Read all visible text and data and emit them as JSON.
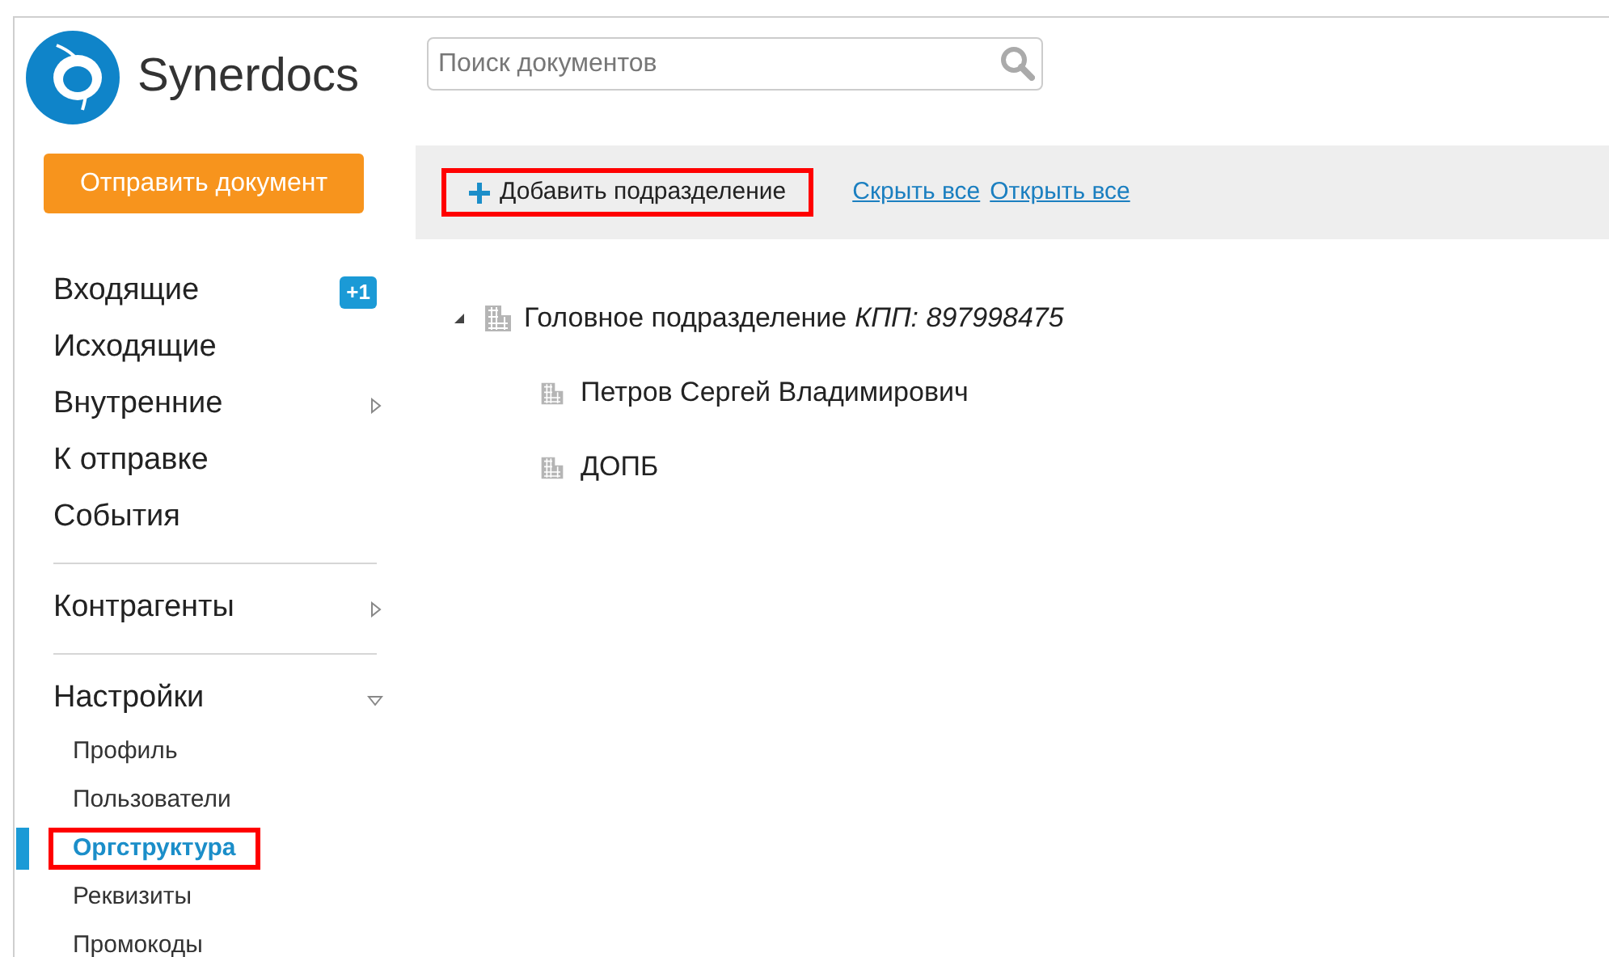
{
  "header": {
    "logo_text": "Synerdocs",
    "search": {
      "placeholder": "Поиск документов"
    }
  },
  "send_button": "Отправить документ",
  "toolbar": {
    "add_button": {
      "label": "Добавить подразделение",
      "highlighted": true
    },
    "links": [
      "Скрыть все",
      "Открыть все"
    ]
  },
  "nav": {
    "groups": [
      {
        "items": [
          {
            "label": "Входящие",
            "badge": "+1"
          },
          {
            "label": "Исходящие"
          },
          {
            "label": "Внутренние",
            "expanded": false
          },
          {
            "label": "К отправке"
          },
          {
            "label": "События"
          }
        ]
      },
      {
        "items": [
          {
            "label": "Контрагенты",
            "expanded": false
          }
        ]
      },
      {
        "items": [
          {
            "label": "Настройки",
            "expanded": true,
            "children": [
              {
                "label": "Профиль",
                "selected": false,
                "highlighted": false
              },
              {
                "label": "Пользователи",
                "selected": false,
                "highlighted": false
              },
              {
                "label": "Оргструктура",
                "selected": true,
                "highlighted": true
              },
              {
                "label": "Реквизиты",
                "selected": false,
                "highlighted": false
              },
              {
                "label": "Промокоды",
                "selected": false,
                "highlighted": false
              }
            ]
          }
        ]
      }
    ]
  },
  "tree": [
    {
      "label": "Головное подразделение",
      "detail": "КПП: 897998475",
      "expanded": true,
      "children": [
        {
          "label": "Петров Сергей Владимирович"
        },
        {
          "label": "ДОПБ"
        }
      ]
    }
  ]
}
